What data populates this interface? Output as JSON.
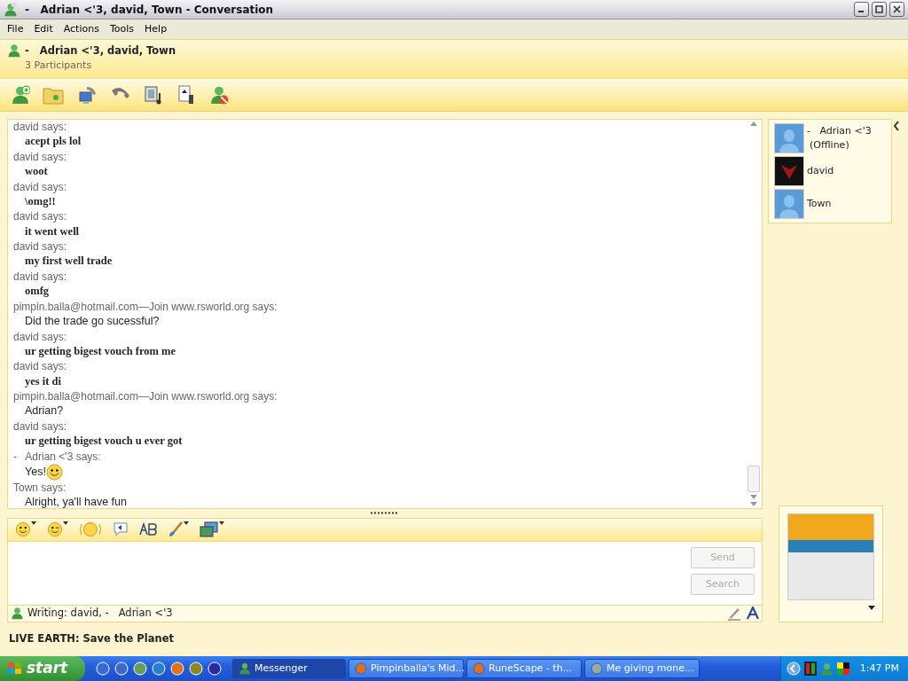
{
  "window": {
    "title": "-   Adrian <'3, david, Town - Conversation"
  },
  "menu": [
    "File",
    "Edit",
    "Actions",
    "Tools",
    "Help"
  ],
  "header": {
    "title": "-   Adrian <'3, david, Town",
    "subtitle": "3 Participants"
  },
  "messages": [
    {
      "sender": "david says:",
      "text": "acept pls lol",
      "kind": "bold"
    },
    {
      "sender": "david says:",
      "text": "woot",
      "kind": "bold"
    },
    {
      "sender": "david says:",
      "text": "\\omg!!",
      "kind": "bold"
    },
    {
      "sender": "david says:",
      "text": "it went well",
      "kind": "bold"
    },
    {
      "sender": "david says:",
      "text": "my first well trade",
      "kind": "bold"
    },
    {
      "sender": "david says:",
      "text": "omfg",
      "kind": "bold"
    },
    {
      "sender": "pimpin.balla@hotmail.com—Join www.rsworld.org says:",
      "text": "Did the trade go sucessful?",
      "kind": "plain"
    },
    {
      "sender": "david says:",
      "text": "ur getting bigest vouch from me",
      "kind": "bold"
    },
    {
      "sender": "david says:",
      "text": "yes it di",
      "kind": "bold"
    },
    {
      "sender": "pimpin.balla@hotmail.com—Join www.rsworld.org says:",
      "text": "Adrian?",
      "kind": "plain"
    },
    {
      "sender": "david says:",
      "text": "ur getting bigest vouch u ever got",
      "kind": "bold"
    },
    {
      "sender": "-   Adrian <'3 says:",
      "text": "Yes!",
      "kind": "smiley"
    },
    {
      "sender": "Town says:",
      "text": "Alright, ya'll have fun",
      "kind": "plain"
    }
  ],
  "participants": [
    {
      "name": "-   Adrian <'3",
      "status": "(Offline)",
      "kind": "default"
    },
    {
      "name": "david",
      "kind": "picture"
    },
    {
      "name": "Town",
      "kind": "default"
    }
  ],
  "buttons": [
    {
      "label": "Send",
      "disabled": true
    },
    {
      "label": "Search",
      "disabled": true
    }
  ],
  "writing": "Writing: david, -   Adrian <'3",
  "footer": "LIVE EARTH: Save the Planet",
  "taskbar": {
    "start": "start",
    "tasks": [
      {
        "label": "Messenger",
        "selected": true
      },
      {
        "label": "Pimpinballa's Mid...",
        "selected": false
      },
      {
        "label": "RuneScape - th...",
        "selected": false
      },
      {
        "label": "Me giving mone...",
        "selected": false
      }
    ],
    "clock": "1:47 PM"
  }
}
